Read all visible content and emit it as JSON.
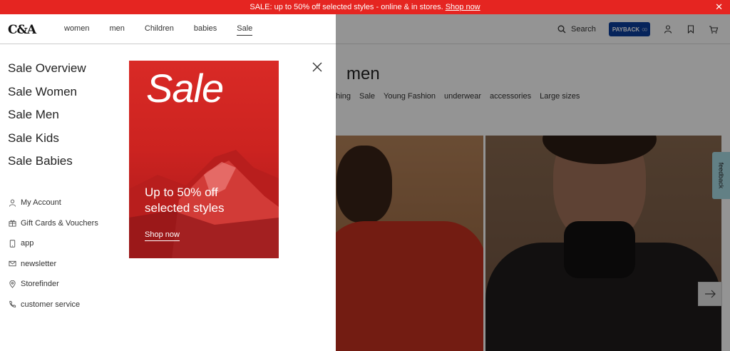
{
  "promo": {
    "text": "SALE: up to 50% off selected styles - online & in stores.",
    "link": "Shop now",
    "close": "✕"
  },
  "header": {
    "logo": "C&A",
    "nav": [
      "women",
      "men",
      "Children",
      "babies",
      "Sale"
    ],
    "active_nav": "Sale",
    "search_label": "Search",
    "payback_label": "PAYBACK"
  },
  "page": {
    "title": "men",
    "categories": [
      "othing",
      "Sale",
      "Young Fashion",
      "underwear",
      "accessories",
      "Large sizes"
    ],
    "feedback_label": "feedback"
  },
  "menu": {
    "sale_links": [
      "Sale Overview",
      "Sale Women",
      "Sale Men",
      "Sale Kids",
      "Sale Babies"
    ],
    "util_links": [
      {
        "label": "My Account",
        "icon": "person-icon"
      },
      {
        "label": "Gift Cards & Vouchers",
        "icon": "gift-icon"
      },
      {
        "label": "app",
        "icon": "phone-icon"
      },
      {
        "label": "newsletter",
        "icon": "mail-icon"
      },
      {
        "label": "Storefinder",
        "icon": "location-pin-icon"
      },
      {
        "label": "customer service",
        "icon": "telephone-icon"
      }
    ],
    "banner": {
      "headline": "Sale",
      "line1": "Up to 50% off",
      "line2": "selected styles",
      "cta": "Shop now"
    }
  },
  "colors": {
    "brand_red": "#e52521",
    "payback_blue": "#0b3f9e",
    "feedback_tab": "#a9dde6"
  }
}
